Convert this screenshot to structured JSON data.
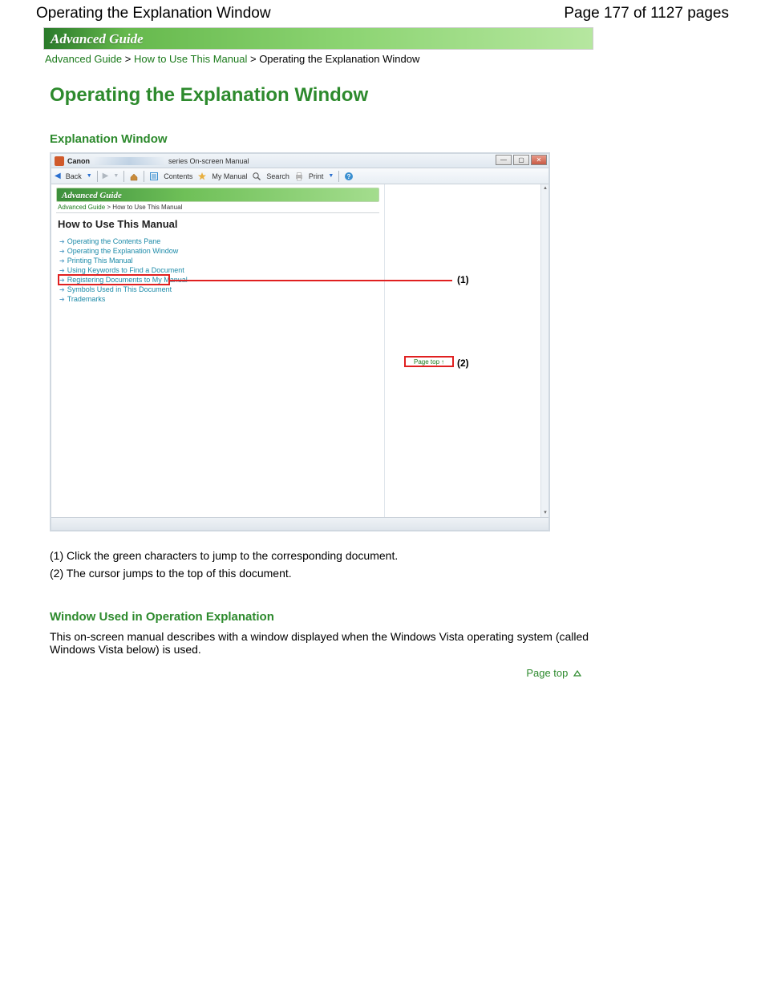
{
  "header": {
    "title": "Operating the Explanation Window",
    "pager": "Page 177 of 1127 pages"
  },
  "banner": "Advanced Guide",
  "breadcrumb": {
    "l1": "Advanced Guide",
    "sep": ">",
    "l2": "How to Use This Manual",
    "current": "Operating the Explanation Window"
  },
  "page_title": "Operating the Explanation Window",
  "section1": "Explanation Window",
  "figure": {
    "titlebar": {
      "brand": "Canon",
      "suffix": "series On-screen Manual",
      "min": "—",
      "max": "▢",
      "close": "✕"
    },
    "toolbar": {
      "back": "Back",
      "contents": "Contents",
      "mymanual": "My Manual",
      "search": "Search",
      "print": "Print"
    },
    "inner_banner": "Advanced Guide",
    "inner_bc_l1": "Advanced Guide",
    "inner_bc_sep": ">",
    "inner_bc_l2": "How to Use This Manual",
    "inner_h2": "How to Use This Manual",
    "links": [
      "Operating the Contents Pane",
      "Operating the Explanation Window",
      "Printing This Manual",
      "Using Keywords to Find a Document",
      "Registering Documents to My Manual",
      "Symbols Used in This Document",
      "Trademarks"
    ],
    "callout1": "(1)",
    "callout2": "(2)",
    "pagetop_box": "Page top"
  },
  "notes": {
    "n1": "(1) Click the green characters to jump to the corresponding document.",
    "n2": "(2) The cursor jumps to the top of this document."
  },
  "section2": "Window Used in Operation Explanation",
  "body2": "This on-screen manual describes with a window displayed when the Windows Vista operating system (called Windows Vista below) is used.",
  "pagetop": "Page top"
}
